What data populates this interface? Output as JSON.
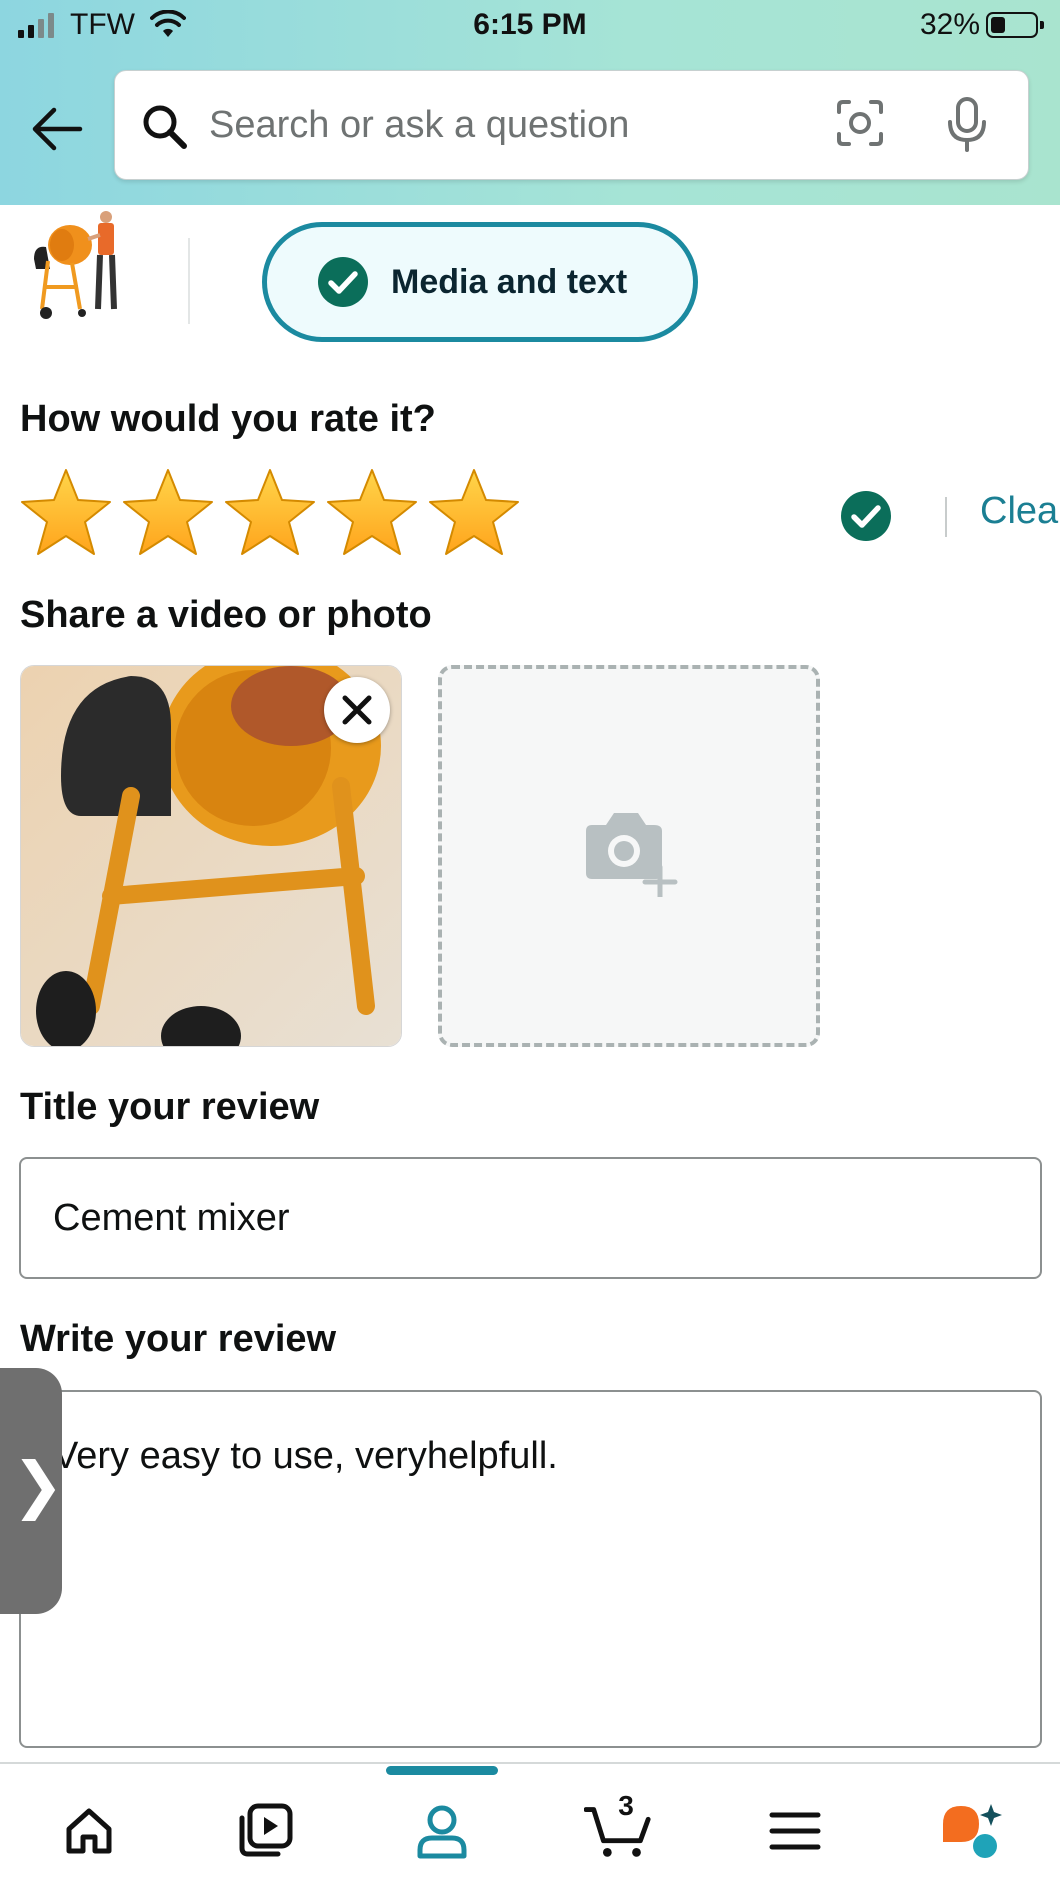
{
  "status_bar": {
    "carrier": "TFW",
    "time": "6:15 PM",
    "battery_percent": "32%",
    "battery_level": 0.32,
    "signal_bars": 2
  },
  "header": {
    "back_icon": "arrow-left-icon",
    "search": {
      "placeholder": "Search or ask a question",
      "value": "",
      "lens_icon": "camera-lens-icon",
      "mic_icon": "microphone-icon"
    }
  },
  "product": {
    "thumbnail_icon": "cement-mixer-thumbnail"
  },
  "mode": {
    "label": "Media and text",
    "selected": true
  },
  "rating": {
    "heading": "How would you rate it?",
    "stars_filled": 5,
    "stars_total": 5,
    "clear_label": "Clear"
  },
  "media": {
    "heading": "Share a video or photo",
    "add_icon": "camera-plus-icon"
  },
  "review_title": {
    "heading": "Title your review",
    "value": "Cement mixer"
  },
  "review_body": {
    "heading": "Write your review",
    "value": "Very easy to use, veryhelpfull."
  },
  "side_tab": {
    "label": "❯"
  },
  "bottom_nav": {
    "items": [
      {
        "name": "home",
        "icon": "home-icon"
      },
      {
        "name": "video",
        "icon": "video-library-icon"
      },
      {
        "name": "account",
        "icon": "person-icon",
        "active": true
      },
      {
        "name": "cart",
        "icon": "cart-icon"
      },
      {
        "name": "menu",
        "icon": "hamburger-menu-icon"
      },
      {
        "name": "rufus",
        "icon": "assistant-icon"
      }
    ],
    "cart_count": "3"
  },
  "colors": {
    "accent": "#1b8aa0",
    "check_green": "#0b6e5a",
    "star_gold": "#ffa41c",
    "link": "#1b7f93"
  }
}
